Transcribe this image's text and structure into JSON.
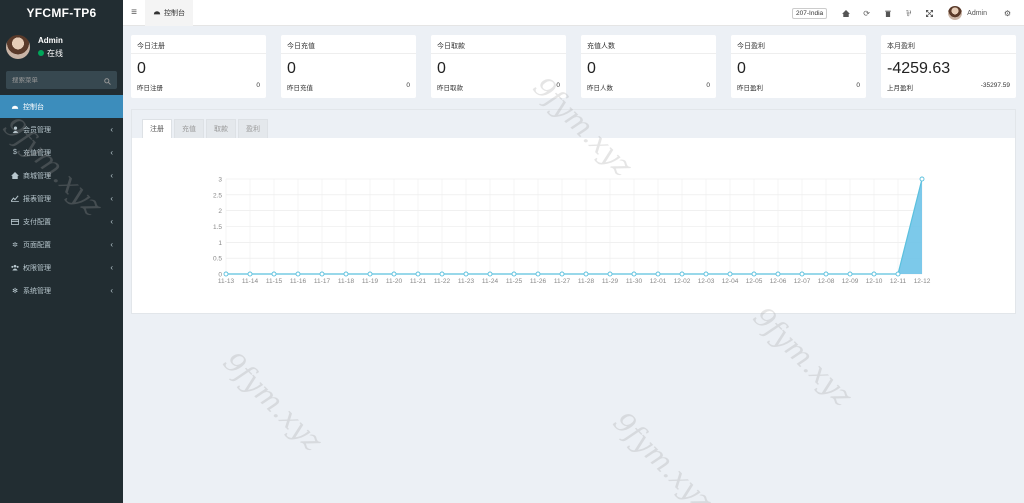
{
  "sidebar": {
    "logo": "YFCMF-TP6",
    "user": {
      "name": "Admin",
      "status": "在线"
    },
    "search_placeholder": "搜索菜单",
    "menu": [
      {
        "label": "控制台",
        "icon": "dashboard-icon",
        "active": true
      },
      {
        "label": "会员管理",
        "icon": "user-icon"
      },
      {
        "label": "充值管理",
        "icon": "dollar-icon"
      },
      {
        "label": "商城管理",
        "icon": "home-icon"
      },
      {
        "label": "报表管理",
        "icon": "chart-icon"
      },
      {
        "label": "支付配置",
        "icon": "card-icon"
      },
      {
        "label": "页面配置",
        "icon": "gear-icon"
      },
      {
        "label": "权限管理",
        "icon": "users-icon"
      },
      {
        "label": "系统管理",
        "icon": "gears-icon"
      }
    ]
  },
  "topbar": {
    "tab_label": "控制台",
    "lang": "207-India",
    "user": "Admin"
  },
  "cards": [
    {
      "title": "今日注册",
      "value": "0",
      "foot_label": "昨日注册",
      "foot_value": "0"
    },
    {
      "title": "今日充值",
      "value": "0",
      "foot_label": "昨日充值",
      "foot_value": "0"
    },
    {
      "title": "今日取款",
      "value": "0",
      "foot_label": "昨日取款",
      "foot_value": "0"
    },
    {
      "title": "充值人数",
      "value": "0",
      "foot_label": "昨日人数",
      "foot_value": "0"
    },
    {
      "title": "今日盈利",
      "value": "0",
      "foot_label": "昨日盈利",
      "foot_value": "0"
    },
    {
      "title": "本月盈利",
      "value": "-4259.63",
      "foot_label": "上月盈利",
      "foot_value": "-35297.59"
    }
  ],
  "chart_tabs": [
    "注册",
    "充值",
    "取款",
    "盈利"
  ],
  "watermark": "9fym.xyz",
  "colors": {
    "accent": "#3c8dbc",
    "line": "#5bc0de",
    "fill": "#6ec3e8",
    "sidebar": "#222d32"
  },
  "chart_data": {
    "type": "area",
    "x": [
      "11-13",
      "11-14",
      "11-15",
      "11-16",
      "11-17",
      "11-18",
      "11-19",
      "11-20",
      "11-21",
      "11-22",
      "11-23",
      "11-24",
      "11-25",
      "11-26",
      "11-27",
      "11-28",
      "11-29",
      "11-30",
      "12-01",
      "12-02",
      "12-03",
      "12-04",
      "12-05",
      "12-06",
      "12-07",
      "12-08",
      "12-09",
      "12-10",
      "12-11",
      "12-12"
    ],
    "values": [
      0,
      0,
      0,
      0,
      0,
      0,
      0,
      0,
      0,
      0,
      0,
      0,
      0,
      0,
      0,
      0,
      0,
      0,
      0,
      0,
      0,
      0,
      0,
      0,
      0,
      0,
      0,
      0,
      0,
      3
    ],
    "yticks": [
      "0",
      "0.5",
      "1",
      "1.5",
      "2",
      "2.5",
      "3"
    ],
    "ylim": [
      0,
      3
    ],
    "grid": true
  }
}
